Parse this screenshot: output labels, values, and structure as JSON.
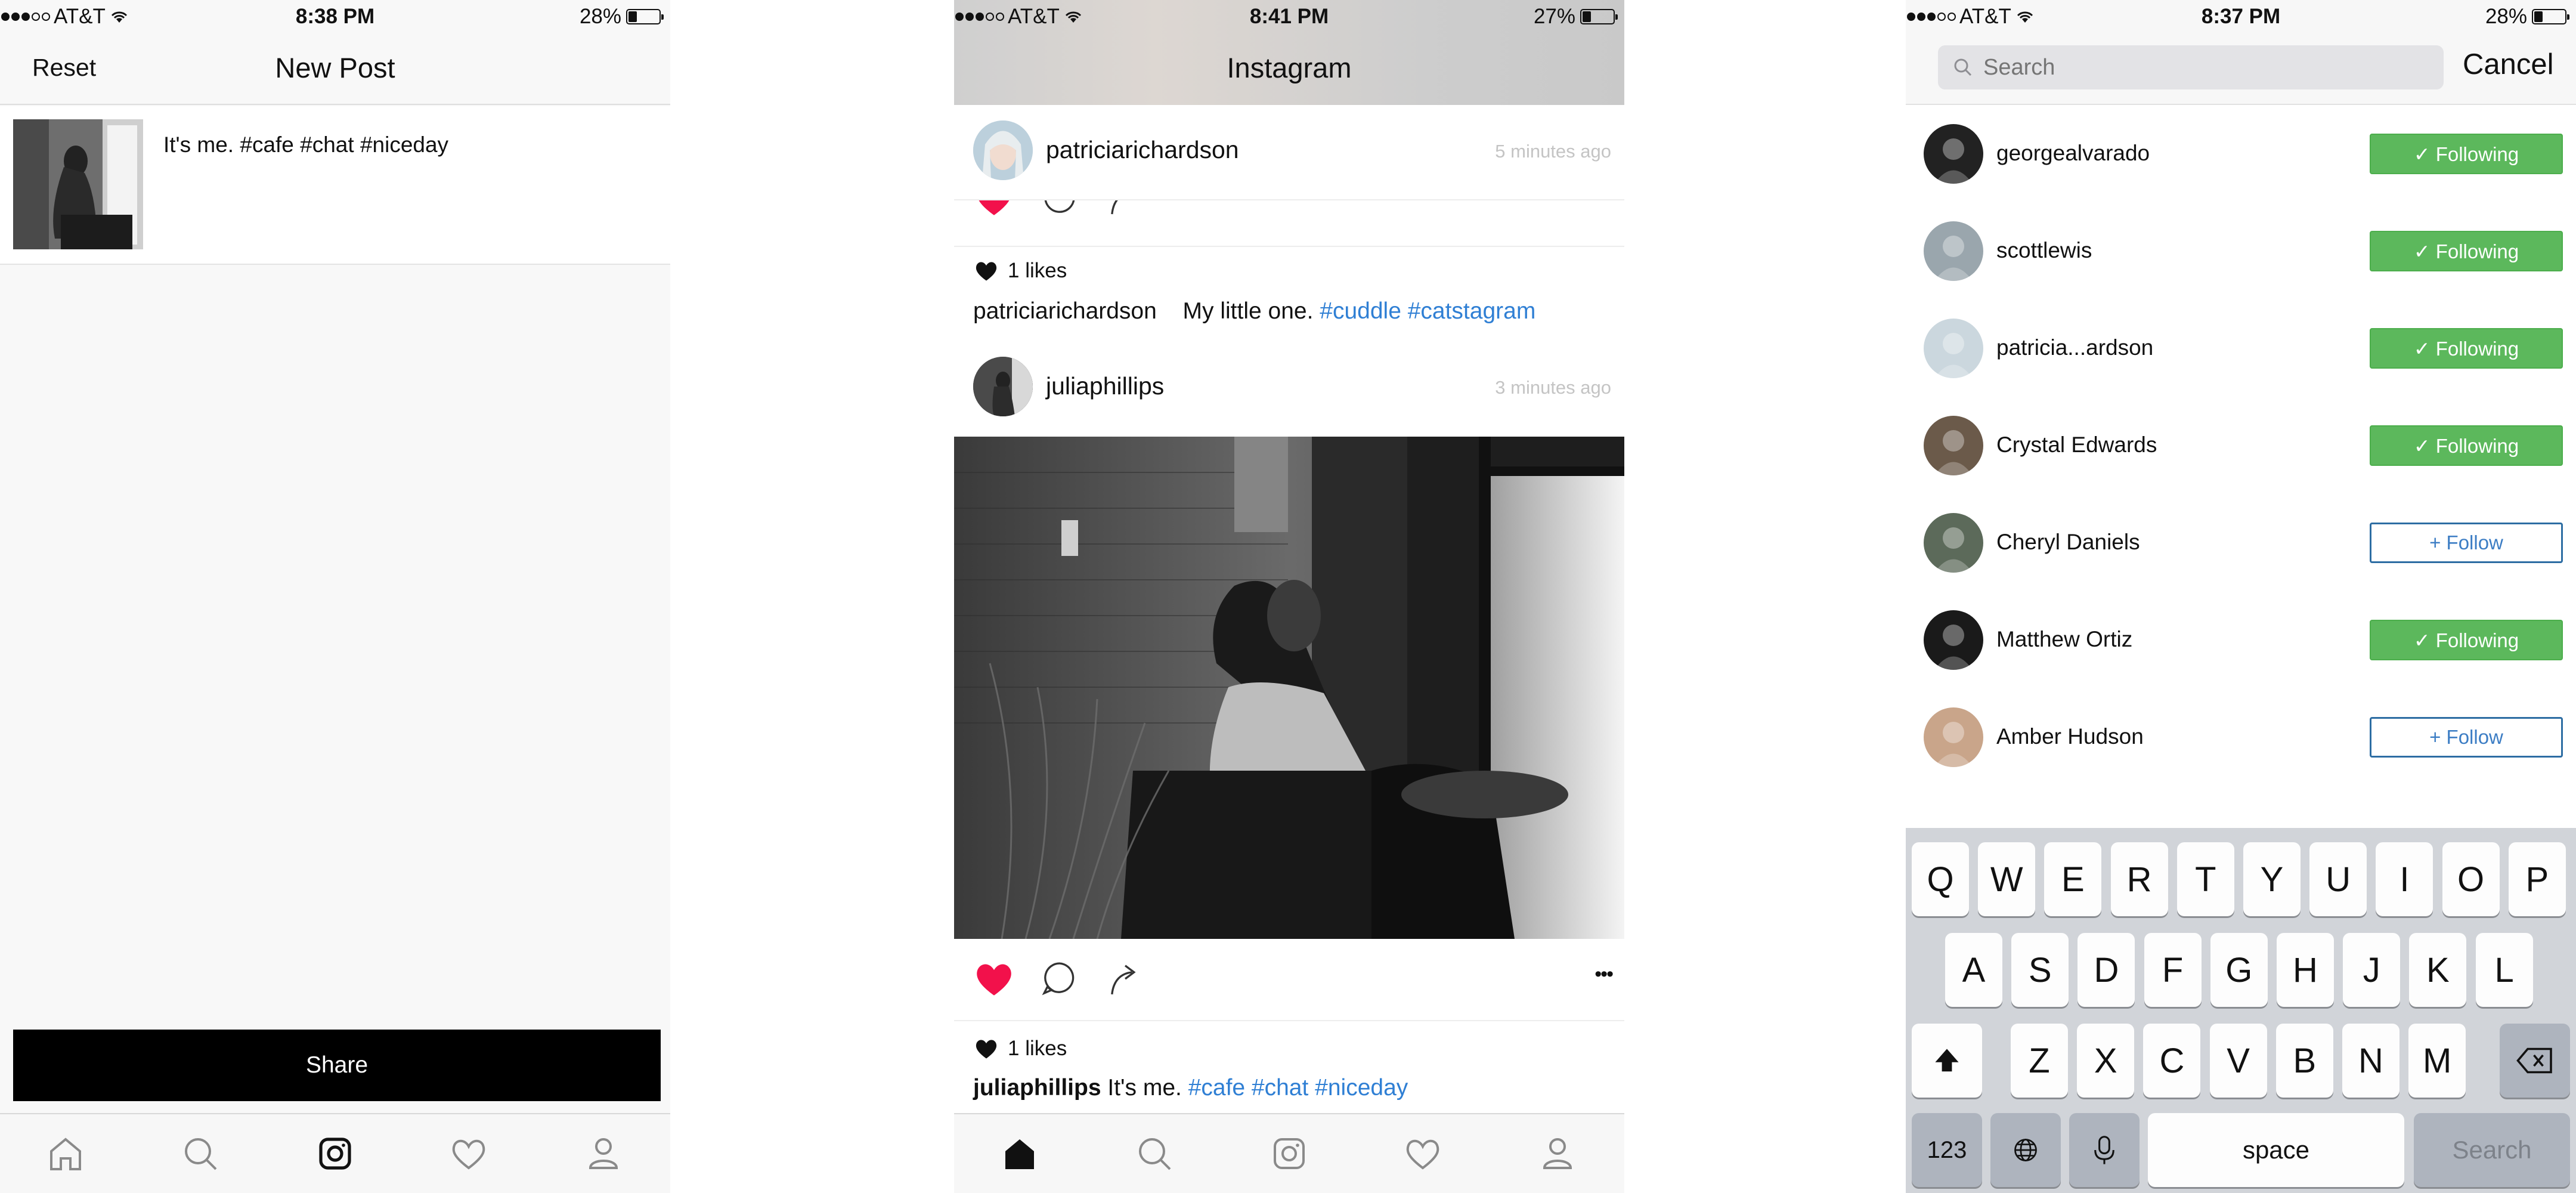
{
  "screen1": {
    "status": {
      "carrier": "AT&T",
      "time": "8:38 PM",
      "battery": "28%",
      "battery_level": 0.28
    },
    "nav": {
      "reset_label": "Reset",
      "title": "New Post"
    },
    "caption": "It's me. #cafe #chat #niceday",
    "share_label": "Share",
    "tabbar": {
      "active": "camera"
    }
  },
  "screen2": {
    "status": {
      "carrier": "AT&T",
      "time": "8:41 PM",
      "battery": "27%",
      "battery_level": 0.27
    },
    "title": "Instagram",
    "post1": {
      "username": "patriciarichardson",
      "time": "5 minutes ago",
      "likes": "1 likes",
      "caption_user": "patriciarichardson",
      "caption_text": "My little one.",
      "caption_tags": "#cuddle #catstagram"
    },
    "post2": {
      "username": "juliaphillips",
      "time": "3 minutes ago",
      "likes": "1 likes",
      "caption_user": "juliaphillips",
      "caption_text": "It's me.",
      "caption_tags": "#cafe #chat #niceday",
      "more_glyph": "•••"
    },
    "tabbar": {
      "active": "home"
    }
  },
  "screen3": {
    "status": {
      "carrier": "AT&T",
      "time": "8:37 PM",
      "battery": "28%",
      "battery_level": 0.28
    },
    "search": {
      "placeholder": "Search",
      "cancel_label": "Cancel"
    },
    "users": [
      {
        "name": "georgealvarado",
        "button": "✓ Following",
        "state": "following"
      },
      {
        "name": "scottlewis",
        "button": "✓ Following",
        "state": "following"
      },
      {
        "name": "patricia...ardson",
        "button": "✓ Following",
        "state": "following"
      },
      {
        "name": "Crystal Edwards",
        "button": "✓ Following",
        "state": "following"
      },
      {
        "name": "Cheryl Daniels",
        "button": "+ Follow",
        "state": "follow"
      },
      {
        "name": "Matthew Ortiz",
        "button": "✓ Following",
        "state": "following"
      },
      {
        "name": "Amber Hudson",
        "button": "+ Follow",
        "state": "follow"
      }
    ],
    "keyboard": {
      "row1": [
        "Q",
        "W",
        "E",
        "R",
        "T",
        "Y",
        "U",
        "I",
        "O",
        "P"
      ],
      "row2": [
        "A",
        "S",
        "D",
        "F",
        "G",
        "H",
        "J",
        "K",
        "L"
      ],
      "row3": [
        "Z",
        "X",
        "C",
        "V",
        "B",
        "N",
        "M"
      ],
      "numbers": "123",
      "space": "space",
      "search": "Search"
    }
  },
  "colors": {
    "heart": "#f2114b",
    "following_green": "#5cb85c",
    "follow_blue": "#2d6da3",
    "hashtag": "#2f7fd4"
  }
}
